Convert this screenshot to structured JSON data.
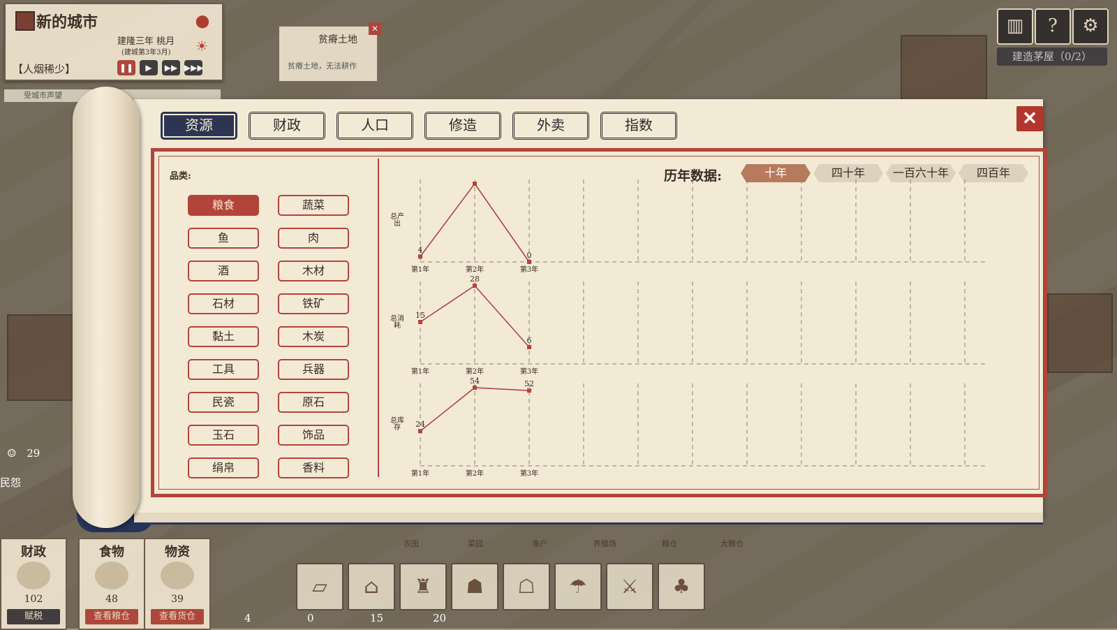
{
  "city": {
    "name": "新的城市",
    "date": "建隆三年 桃月",
    "date_sub": "(建城第3年3月)",
    "status": "【人烟稀少】",
    "speed_buttons": [
      "❚❚",
      "▶",
      "▶▶",
      "▶▶▶"
    ]
  },
  "hint": "受城市声望",
  "tooltip": {
    "title": "贫瘠土地",
    "text": "贫瘠土地，无法耕作"
  },
  "top_right": {
    "build_label": "建造茅屋（0/2）"
  },
  "left_stats": {
    "happiness_value": "29",
    "unrest_label": "民怨"
  },
  "bottom_panels": [
    {
      "title": "财政",
      "value": "102",
      "button": "赋税"
    },
    {
      "title": "食物",
      "value": "48",
      "button": "查看粮仓"
    },
    {
      "title": "物资",
      "value": "39",
      "button": "查看货仓"
    }
  ],
  "bottom_labels": [
    "农田",
    "菜园",
    "渔户",
    "养殖场",
    "粮仓",
    "大粮仓"
  ],
  "bottom_counts": [
    "4",
    "0",
    "15",
    "20"
  ],
  "tabs": [
    {
      "label": "资源",
      "active": true
    },
    {
      "label": "财政",
      "active": false
    },
    {
      "label": "人口",
      "active": false
    },
    {
      "label": "修造",
      "active": false
    },
    {
      "label": "外卖",
      "active": false
    },
    {
      "label": "指数",
      "active": false
    }
  ],
  "categories_label": "品类:",
  "categories": [
    {
      "label": "粮食",
      "active": true
    },
    {
      "label": "蔬菜",
      "active": false
    },
    {
      "label": "鱼",
      "active": false
    },
    {
      "label": "肉",
      "active": false
    },
    {
      "label": "酒",
      "active": false
    },
    {
      "label": "木材",
      "active": false
    },
    {
      "label": "石材",
      "active": false
    },
    {
      "label": "铁矿",
      "active": false
    },
    {
      "label": "黏土",
      "active": false
    },
    {
      "label": "木炭",
      "active": false
    },
    {
      "label": "工具",
      "active": false
    },
    {
      "label": "兵器",
      "active": false
    },
    {
      "label": "民瓷",
      "active": false
    },
    {
      "label": "原石",
      "active": false
    },
    {
      "label": "玉石",
      "active": false
    },
    {
      "label": "饰品",
      "active": false
    },
    {
      "label": "绢帛",
      "active": false
    },
    {
      "label": "香料",
      "active": false
    }
  ],
  "range": {
    "label": "历年数据:",
    "options": [
      {
        "label": "十年",
        "active": true
      },
      {
        "label": "四十年",
        "active": false
      },
      {
        "label": "一百六十年",
        "active": false
      },
      {
        "label": "四百年",
        "active": false
      }
    ]
  },
  "colors": {
    "accent": "#b3443a",
    "navy": "#2d3552",
    "paper": "#f3ead6"
  },
  "chart_data": [
    {
      "type": "line",
      "ylabel": "总产出",
      "categories": [
        "第1年",
        "第2年",
        "第3年"
      ],
      "values": [
        4,
        58,
        0
      ],
      "ylim": [
        0,
        58
      ]
    },
    {
      "type": "line",
      "ylabel": "总消耗",
      "categories": [
        "第1年",
        "第2年",
        "第3年"
      ],
      "values": [
        15,
        28,
        6
      ],
      "ylim": [
        0,
        28
      ]
    },
    {
      "type": "line",
      "ylabel": "总库存",
      "categories": [
        "第1年",
        "第2年",
        "第3年"
      ],
      "values": [
        24,
        54,
        52
      ],
      "ylim": [
        0,
        54
      ]
    }
  ]
}
